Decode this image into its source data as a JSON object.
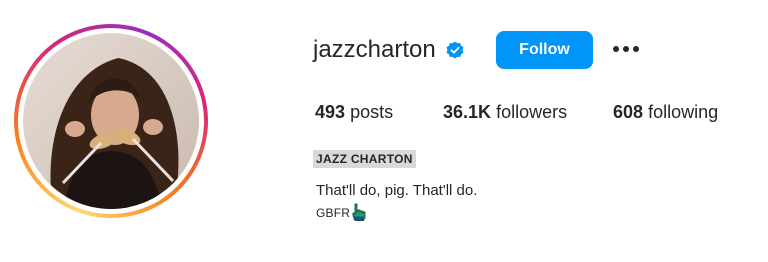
{
  "profile": {
    "username": "jazzcharton",
    "verified_icon": "verified-badge-icon",
    "follow_label": "Follow",
    "more_icon": "more-options-icon",
    "accent_color": "#0095f6",
    "stats": {
      "posts_count": "493",
      "posts_label": "posts",
      "followers_count": "36.1K",
      "followers_label": "followers",
      "following_count": "608",
      "following_label": "following"
    },
    "full_name": "JAZZ CHARTON",
    "bio": "That'll do, pig. That'll do.",
    "bio_tag": "GBFR",
    "bio_tag_icon": "pointing-hand-icon",
    "avatar_icon": "profile-photo"
  }
}
